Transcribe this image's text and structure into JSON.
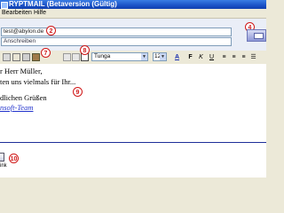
{
  "window": {
    "title": "RYPTMAIL (Betaversion (Gültig)"
  },
  "menu": {
    "items": [
      "Bearbeiten",
      "Hilfe"
    ]
  },
  "header": {
    "to_value": "test@abylon.de",
    "subject_value": "Anschreiben"
  },
  "markers": {
    "m2": "2",
    "m4": "4",
    "m7": "7",
    "m8": "8",
    "m9": "9",
    "m10": "10"
  },
  "toolbar": {
    "font": "Tunga",
    "size": "12",
    "format_buttons": [
      "A",
      "F",
      "K",
      "U"
    ]
  },
  "body": {
    "line1": "r Herr Müller,",
    "line2": "ten uns vielmals für Ihr...",
    "line3": "dlichen Grüßen",
    "line4": "nsoft-Team"
  },
  "attachment": {
    "label": "ink"
  },
  "colors": {
    "title_blue": "#1b52c7",
    "marker_red": "#d01818",
    "link_blue": "#2233cc"
  }
}
